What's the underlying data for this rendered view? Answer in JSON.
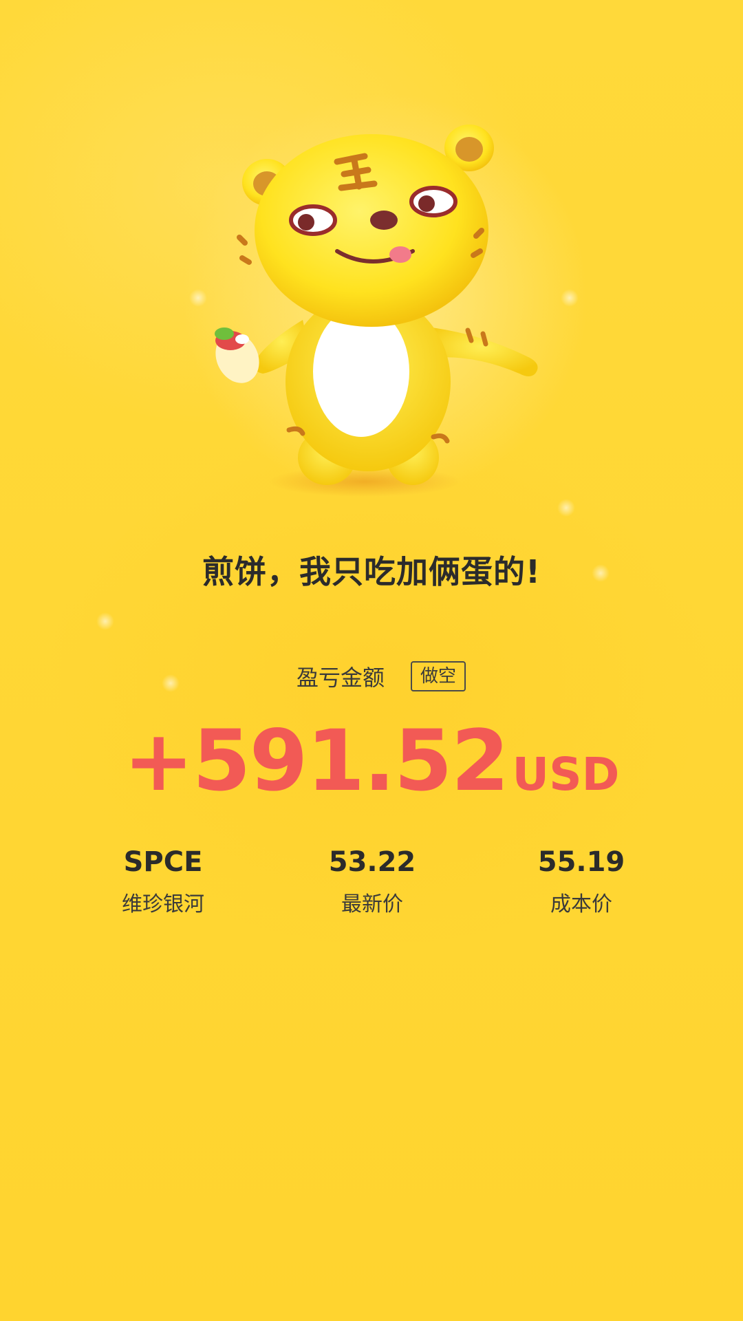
{
  "slogan": "煎饼，我只吃加俩蛋的!",
  "profit": {
    "label": "盈亏金额",
    "direction_badge": "做空",
    "amount": "+591.52",
    "currency": "USD",
    "color": "#F25A55"
  },
  "stats": [
    {
      "value": "SPCE",
      "label": "维珍银河"
    },
    {
      "value": "53.22",
      "label": "最新价"
    },
    {
      "value": "55.19",
      "label": "成本价"
    }
  ],
  "theme": {
    "background": "#FFD735",
    "text_dark": "#2b2b2b"
  },
  "mascot": {
    "icon": "tiger-mascot-holding-pancake-icon"
  }
}
